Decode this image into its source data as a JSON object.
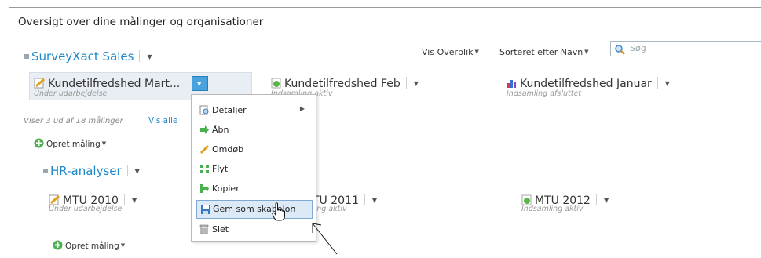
{
  "heading": "Oversigt over dine målinger og organisationer",
  "org": {
    "name": "SurveyXact Sales"
  },
  "toolbar": {
    "view": "Vis Overblik",
    "sort": "Sorteret efter Navn",
    "search_placeholder": "Søg"
  },
  "measurements": [
    {
      "title": "Kundetilfredshed Mart...",
      "status": "Under udarbejdelse"
    },
    {
      "title": "Kundetilfredshed Feb",
      "status": "Indsamling aktiv"
    },
    {
      "title": "Kundetilfredshed Januar",
      "status": "Indsamling afsluttet"
    }
  ],
  "summary": {
    "text": "Viser 3 ud af 18 målinger",
    "show_all": "Vis alle"
  },
  "create_label": "Opret måling",
  "suborg": {
    "name": "HR-analyser",
    "measurements": [
      {
        "title": "MTU 2010",
        "status": "Under udarbejdelse"
      },
      {
        "title": "TU 2011",
        "status": "ling aktiv"
      },
      {
        "title": "MTU 2012",
        "status": "Indsamling aktiv"
      }
    ],
    "create_label": "Opret måling"
  },
  "context_menu": {
    "items": [
      {
        "label": "Detaljer",
        "icon": "details-icon"
      },
      {
        "label": "Åbn",
        "icon": "open-arrow-icon"
      },
      {
        "label": "Omdøb",
        "icon": "pencil-icon"
      },
      {
        "label": "Flyt",
        "icon": "move-icon"
      },
      {
        "label": "Kopier",
        "icon": "copy-arrow-icon"
      },
      {
        "label": "Gem som skabelon",
        "icon": "save-template-icon"
      },
      {
        "label": "Slet",
        "icon": "trash-icon"
      }
    ]
  }
}
